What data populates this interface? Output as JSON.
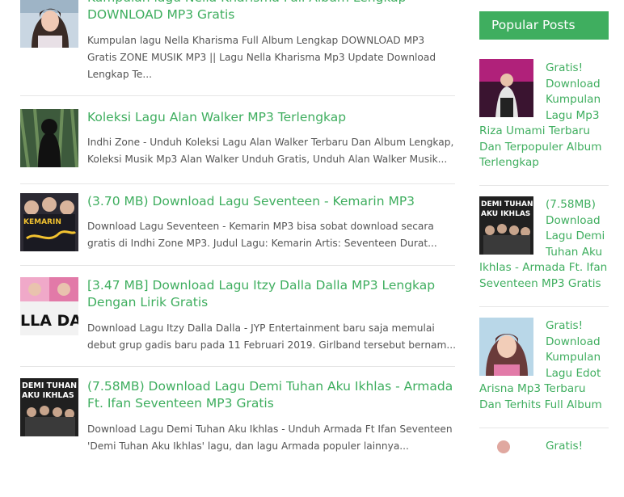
{
  "posts": [
    {
      "title_lines": [
        "Kumpulan lagu Nella Kharisma Full Album Lengkap",
        "DOWNLOAD MP3 Gratis"
      ],
      "excerpt_lines": [
        "Kumpulan lagu Nella Kharisma Full Album Lengkap DOWNLOAD MP3",
        "Gratis ZONE MUSIK MP3 || Lagu Nella Kharisma Mp3 Update Download",
        "Lengkap Te..."
      ],
      "thumb_text": ""
    },
    {
      "title_lines": [
        "Koleksi Lagu Alan Walker MP3 Terlengkap"
      ],
      "excerpt_lines": [
        "Indhi Zone - Unduh Koleksi Lagu Alan Walker Terbaru Dan Album Lengkap,",
        "Koleksi Musik Mp3 Alan Walker Unduh Gratis, Unduh Alan Walker Musik..."
      ],
      "thumb_text": ""
    },
    {
      "title_lines": [
        "(3.70 MB) Download Lagu Seventeen - Kemarin MP3"
      ],
      "excerpt_lines": [
        "Download Lagu Seventeen - Kemarin MP3 bisa sobat download secara",
        "gratis di Indhi Zone MP3. Judul Lagu: Kemarin Artis: Seventeen Durat..."
      ],
      "thumb_text": "KEMARIN"
    },
    {
      "title_lines": [
        "[3.47 MB] Download Lagu Itzy Dalla Dalla MP3 Lengkap",
        "Dengan Lirik Gratis"
      ],
      "excerpt_lines": [
        "Download Lagu Itzy Dalla Dalla - JYP Entertainment baru saja memulai",
        "debut grup gadis baru pada 11 Februari 2019. Girlband tersebut bernam..."
      ],
      "thumb_text": "LLA DAL"
    },
    {
      "title_lines": [
        "(7.58MB) Download Lagu Demi Tuhan Aku Ikhlas - Armada",
        "Ft. Ifan Seventeen MP3 Gratis"
      ],
      "excerpt_lines": [
        "Download Lagu Demi Tuhan Aku Ikhlas - Unduh Armada Ft Ifan Seventeen",
        "'Demi Tuhan Aku Ikhlas' lagu, dan lagu Armada populer lainnya..."
      ],
      "thumb_text": "DEMI TUHAN AKU IKHLAS"
    }
  ],
  "sidebar": {
    "title": "Popular Posts",
    "items": [
      {
        "right_lines": [
          "Gratis!",
          "Download",
          "Kumpulan",
          "Lagu Mp3"
        ],
        "full_lines": [
          "Riza Umami Terbaru",
          "Dan Terpopuler Album",
          "Terlengkap"
        ],
        "thumb_text": ""
      },
      {
        "right_lines": [
          "(7.58MB)",
          "Download",
          "Lagu Demi",
          "Tuhan Aku"
        ],
        "full_lines": [
          "Ikhlas - Armada Ft. Ifan",
          "Seventeen MP3 Gratis"
        ],
        "thumb_text": "DEMI TUHAN AKU IKHLAS"
      },
      {
        "right_lines": [
          "Gratis!",
          "Download",
          "Kumpulan",
          "Lagu Edot"
        ],
        "full_lines": [
          "Arisna Mp3 Terbaru",
          "Dan Terhits Full Album"
        ],
        "thumb_text": ""
      },
      {
        "right_lines": [
          "Gratis!"
        ],
        "full_lines": [],
        "thumb_text": ""
      }
    ]
  },
  "colors": {
    "accent": "#3fae5f",
    "text": "#555555",
    "divider": "#e6e6e6"
  }
}
